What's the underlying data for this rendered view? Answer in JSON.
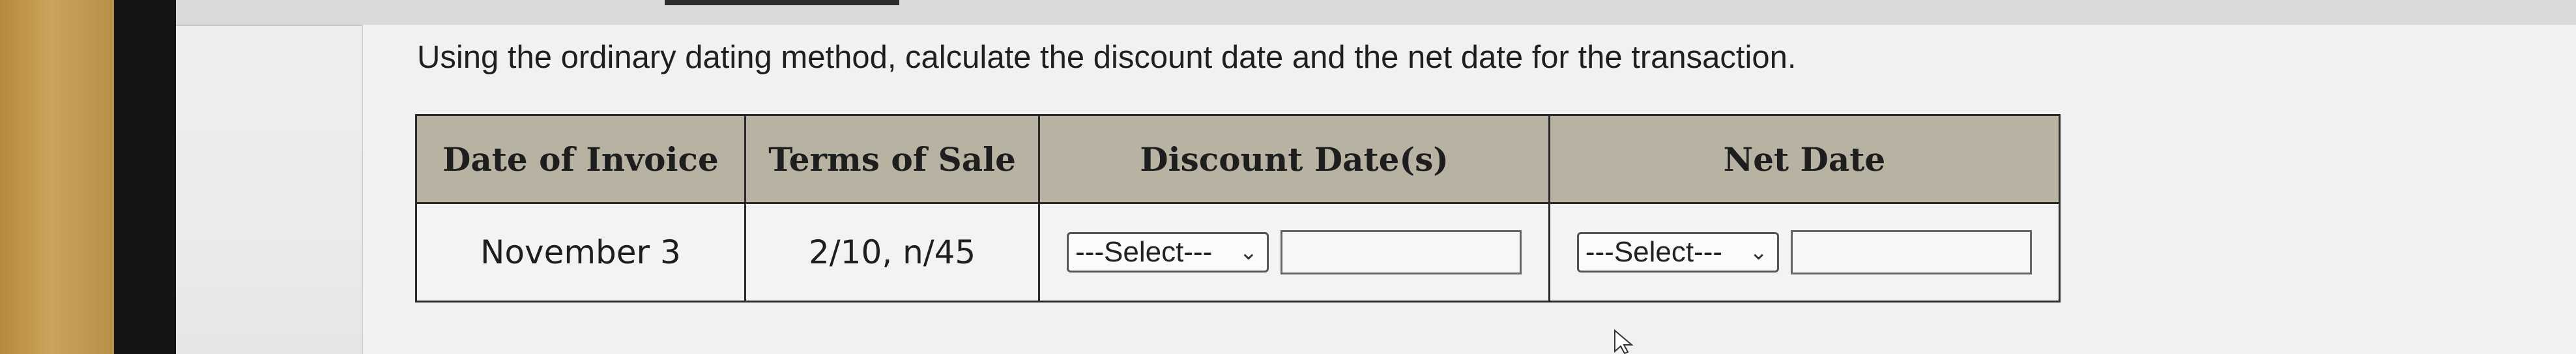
{
  "question": {
    "text": "Using the ordinary dating method, calculate the discount date and the net date for the transaction."
  },
  "table": {
    "headers": [
      "Date of Invoice",
      "Terms of Sale",
      "Discount Date(s)",
      "Net Date"
    ],
    "row": {
      "date_of_invoice": "November 3",
      "terms_of_sale": "2/10, n/45",
      "discount_select": "---Select---",
      "discount_input": "",
      "net_select": "---Select---",
      "net_input": ""
    }
  },
  "colors": {
    "header_bg": "#b7b2a2",
    "invoice_date_text": "#c6281e"
  }
}
